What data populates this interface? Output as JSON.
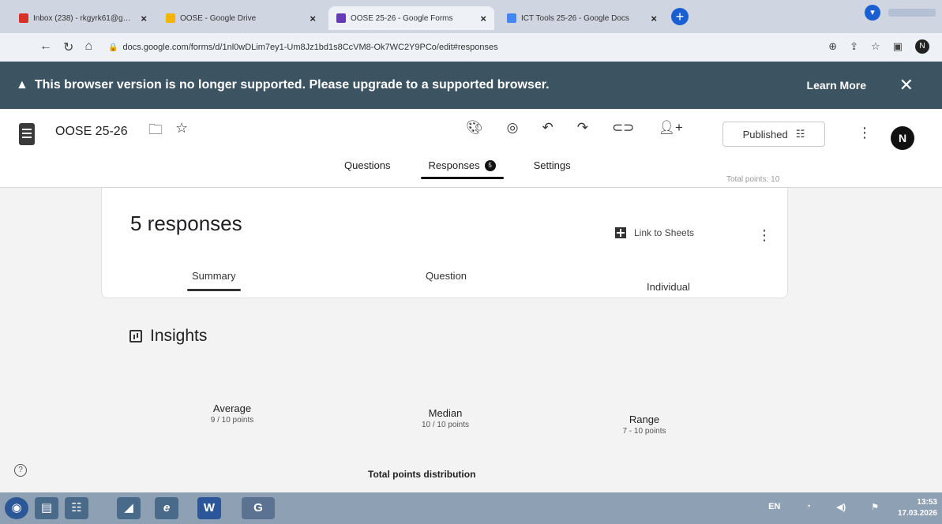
{
  "browser": {
    "tabs": [
      {
        "label": "Inbox (238) - rkgyrk61@gmail.c",
        "close": "×",
        "color": "#d93025"
      },
      {
        "label": "OOSE - Google Drive",
        "close": "×",
        "color": "#f4b400"
      },
      {
        "label": "OOSE 25-26 - Google Forms",
        "close": "×",
        "color": "#673ab7"
      },
      {
        "label": "ICT Tools 25-26 - Google Docs",
        "close": "×",
        "color": "#4285f4"
      }
    ],
    "new_tab": "+",
    "url": "docs.google.com/forms/d/1nl0wDLim7ey1-Um8Jz1bd1s8CcVM8-Ok7WC2Y9PCo/edit#responses"
  },
  "banner": {
    "message": "This browser version is no longer supported. Please upgrade to a supported browser.",
    "learn_more": "Learn More",
    "close": "✕"
  },
  "header": {
    "title": "OOSE 25-26",
    "publish_label": "Published",
    "avatar": "N"
  },
  "form_tabs": {
    "questions": "Questions",
    "responses": "Responses",
    "responses_count": "5",
    "settings": "Settings",
    "total_points": "Total points: 10"
  },
  "summary": {
    "responses_title": "5 responses",
    "link_to_sheets": "Link to Sheets",
    "sub_tabs": {
      "summary": "Summary",
      "question": "Question",
      "individual": "Individual"
    }
  },
  "insights": {
    "title": "Insights",
    "average": {
      "label": "Average",
      "value": "9 / 10 points"
    },
    "median": {
      "label": "Median",
      "value": "10 / 10 points"
    },
    "range": {
      "label": "Range",
      "value": "7 - 10 points"
    },
    "distribution_title": "Total points distribution"
  },
  "taskbar": {
    "tray_lang": "EN",
    "time": "13:53",
    "date": "17.03.2026"
  }
}
